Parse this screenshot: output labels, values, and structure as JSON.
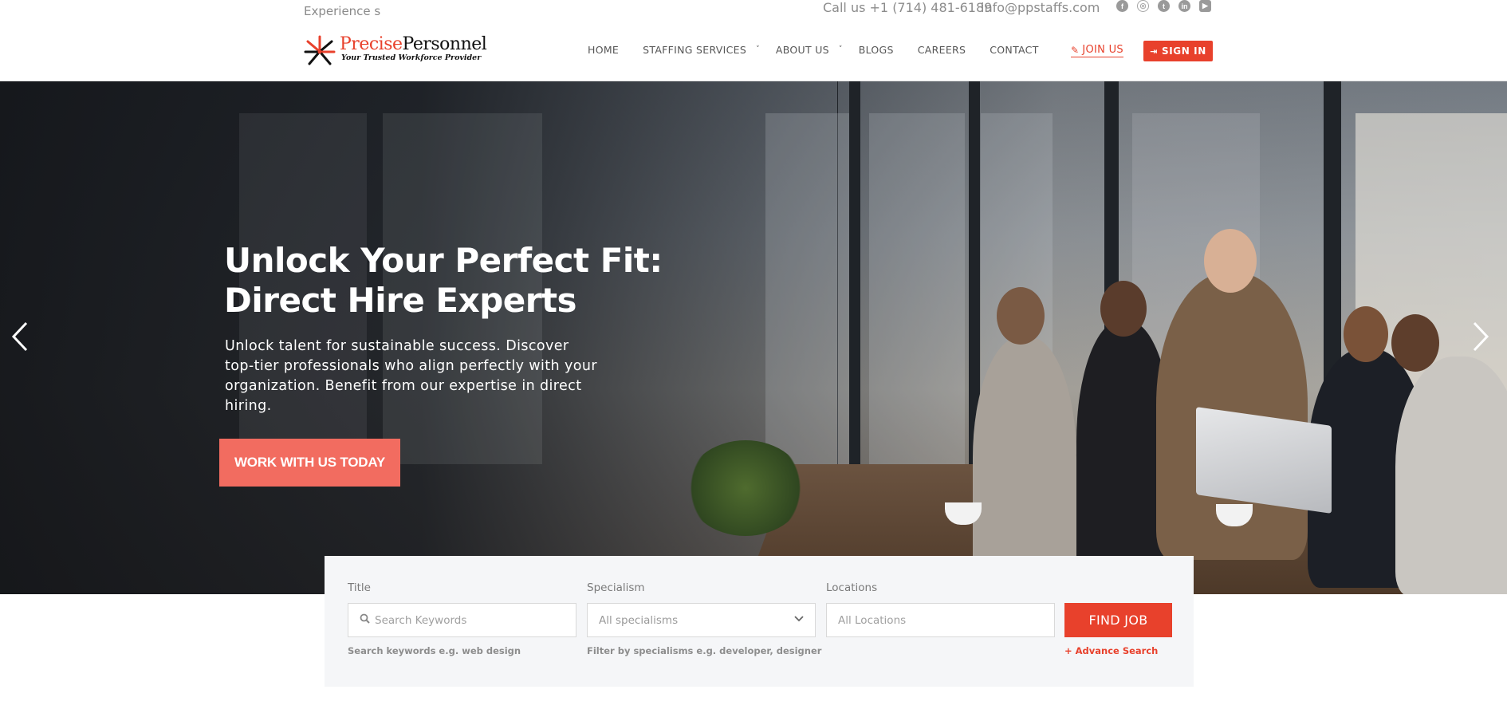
{
  "topbar": {
    "tagline": "Experience s",
    "phone": "Call us +1 (714) 481-6189",
    "email": "info@ppstaffs.com",
    "socials": [
      "facebook-icon",
      "rss-icon",
      "twitter-icon",
      "linkedin-icon",
      "youtube-icon"
    ]
  },
  "logo": {
    "name_part1": "Precise",
    "name_part2": "Personnel",
    "slogan": "Your Trusted Workforce Provider"
  },
  "nav": {
    "items": [
      {
        "label": "HOME",
        "has_dropdown": false
      },
      {
        "label": "STAFFING SERVICES",
        "has_dropdown": true
      },
      {
        "label": "ABOUT US",
        "has_dropdown": true
      },
      {
        "label": "BLOGS",
        "has_dropdown": false
      },
      {
        "label": "CAREERS",
        "has_dropdown": false
      },
      {
        "label": "CONTACT",
        "has_dropdown": false
      }
    ],
    "join_label": "JOIN US",
    "signin_label": "SIGN IN"
  },
  "hero": {
    "title_line1": "Unlock Your Perfect Fit:",
    "title_line2": "Direct Hire Experts",
    "subtitle": "Unlock talent for sustainable success. Discover top-tier professionals who align perfectly with your organization. Benefit from our expertise in direct hiring.",
    "cta_label": "WORK WITH US TODAY"
  },
  "search": {
    "title_label": "Title",
    "title_placeholder": "Search Keywords",
    "title_hint": "Search keywords e.g. web design",
    "specialism_label": "Specialism",
    "specialism_value": "All specialisms",
    "specialism_hint": "Filter by specialisms e.g. developer, designer",
    "locations_label": "Locations",
    "locations_placeholder": "All Locations",
    "find_label": "FIND JOB",
    "advanced_label": "+ Advance Search"
  },
  "colors": {
    "brand_red": "#e8412c",
    "cta_coral": "#f26c60",
    "text_gray": "#555555"
  }
}
